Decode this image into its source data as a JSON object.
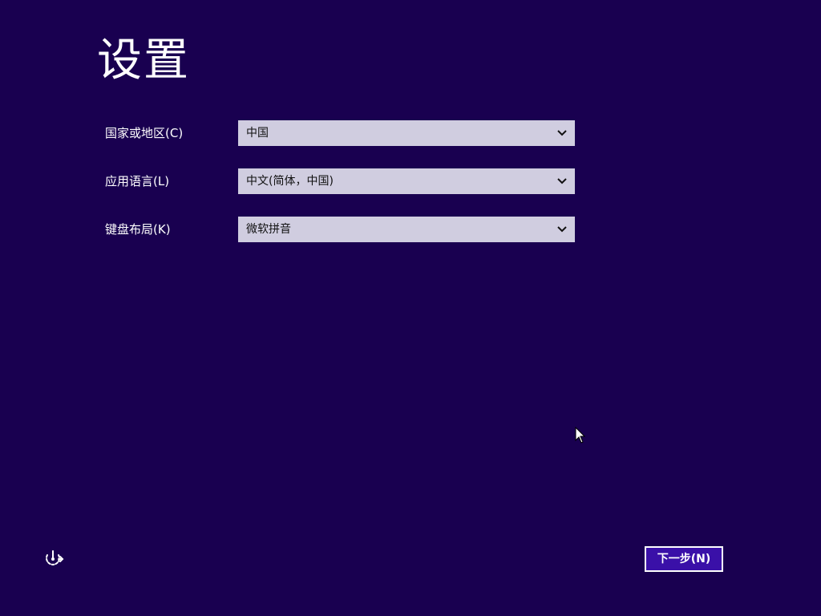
{
  "page": {
    "title": "设置"
  },
  "fields": [
    {
      "label": "国家或地区(C)",
      "value": "中国"
    },
    {
      "label": "应用语言(L)",
      "value": "中文(简体，中国)"
    },
    {
      "label": "键盘布局(K)",
      "value": "微软拼音"
    }
  ],
  "buttons": {
    "next_label": "下一步(N)"
  },
  "icons": {
    "accessibility": "accessibility-icon",
    "dropdown": "chevron-down-icon",
    "cursor": "mouse-cursor-icon"
  },
  "colors": {
    "background": "#190050",
    "select_background": "#d0cde0",
    "button_background": "#3a10a8",
    "text": "#ffffff"
  }
}
